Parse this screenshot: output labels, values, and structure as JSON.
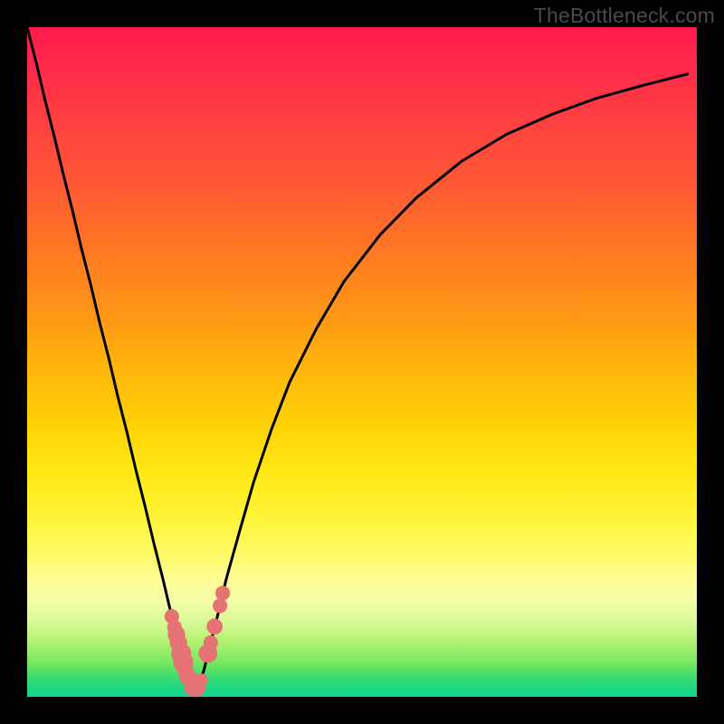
{
  "watermark": {
    "text": "TheBottleneck.com"
  },
  "colors": {
    "frame": "#000000",
    "curve": "#000000",
    "marker": "#e57373",
    "gradient_stops": [
      "#ff1a4c",
      "#ff2a4a",
      "#ff4040",
      "#ff5a33",
      "#ff7a22",
      "#ff9a14",
      "#ffb90a",
      "#ffd406",
      "#ffe814",
      "#fff230",
      "#fffa60",
      "#fdfd9a",
      "#f3fca8",
      "#d8f892",
      "#aef170",
      "#74e85e",
      "#3ddc70",
      "#1fd882",
      "#16d68c"
    ]
  },
  "chart_data": {
    "type": "line",
    "title": "",
    "xlabel": "",
    "ylabel": "",
    "xlim": [
      0,
      100
    ],
    "ylim": [
      0,
      100
    ],
    "grid": false,
    "legend": false,
    "x": [
      0.0,
      1.4,
      2.7,
      4.1,
      5.4,
      6.8,
      8.1,
      9.5,
      10.8,
      12.2,
      13.5,
      14.9,
      16.2,
      17.6,
      18.9,
      20.3,
      21.6,
      23.0,
      23.6,
      24.3,
      25.0,
      25.7,
      26.4,
      27.0,
      28.4,
      29.7,
      31.8,
      33.8,
      36.5,
      39.2,
      43.2,
      47.3,
      52.7,
      58.1,
      64.9,
      71.6,
      78.4,
      85.1,
      91.9,
      98.6
    ],
    "y": [
      100.0,
      94.5,
      89.0,
      83.5,
      78.0,
      72.5,
      67.0,
      61.5,
      56.0,
      50.5,
      45.0,
      39.5,
      34.0,
      28.5,
      23.0,
      17.5,
      12.0,
      6.5,
      4.0,
      2.0,
      0.5,
      2.0,
      4.0,
      6.5,
      12.0,
      17.5,
      25.0,
      32.0,
      40.0,
      47.0,
      55.0,
      62.0,
      69.0,
      74.5,
      80.0,
      84.0,
      87.0,
      89.4,
      91.3,
      93.0
    ],
    "vertex_x": 25.0,
    "markers": [
      {
        "x": 21.6,
        "y": 12.0,
        "r": 1.1
      },
      {
        "x": 22.0,
        "y": 10.4,
        "r": 1.1
      },
      {
        "x": 22.3,
        "y": 9.3,
        "r": 1.3
      },
      {
        "x": 22.6,
        "y": 8.1,
        "r": 1.3
      },
      {
        "x": 23.0,
        "y": 6.5,
        "r": 1.5
      },
      {
        "x": 23.3,
        "y": 5.2,
        "r": 1.5
      },
      {
        "x": 23.6,
        "y": 4.0,
        "r": 1.2
      },
      {
        "x": 24.0,
        "y": 3.0,
        "r": 1.3
      },
      {
        "x": 24.7,
        "y": 1.3,
        "r": 1.2
      },
      {
        "x": 25.4,
        "y": 1.3,
        "r": 1.2
      },
      {
        "x": 26.0,
        "y": 2.5,
        "r": 1.0
      },
      {
        "x": 27.0,
        "y": 6.5,
        "r": 1.4
      },
      {
        "x": 27.4,
        "y": 8.1,
        "r": 1.1
      },
      {
        "x": 28.0,
        "y": 10.5,
        "r": 1.2
      },
      {
        "x": 28.8,
        "y": 13.6,
        "r": 1.1
      },
      {
        "x": 29.2,
        "y": 15.5,
        "r": 1.1
      }
    ]
  }
}
